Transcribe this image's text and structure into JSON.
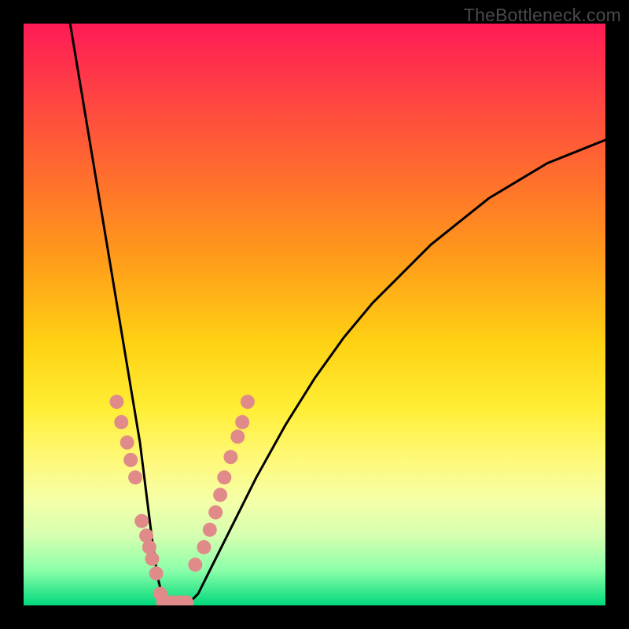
{
  "watermark": {
    "text": "TheBottleneck.com"
  },
  "chart_data": {
    "type": "line",
    "title": "",
    "xlabel": "",
    "ylabel": "",
    "xlim": [
      0,
      100
    ],
    "ylim": [
      0,
      100
    ],
    "grid": false,
    "series": [
      {
        "name": "bottleneck-curve",
        "description": "V-shaped bottleneck curve",
        "x": [
          8,
          10,
          12,
          14,
          16,
          18,
          20,
          21,
          22,
          23,
          24,
          25,
          26,
          28,
          30,
          32,
          35,
          40,
          45,
          50,
          55,
          60,
          65,
          70,
          75,
          80,
          85,
          90,
          95,
          100
        ],
        "y": [
          100,
          88,
          76,
          64,
          52,
          40,
          28,
          20,
          12,
          5,
          1,
          0,
          0,
          0,
          2,
          6,
          12,
          22,
          31,
          39,
          46,
          52,
          57,
          62,
          66,
          70,
          73,
          76,
          78,
          80
        ]
      }
    ],
    "markers": [
      {
        "name": "data-points-left",
        "color": "#e08b89",
        "x": [
          16.0,
          16.8,
          17.8,
          18.4,
          19.2,
          20.3,
          21.1,
          21.6,
          22.1,
          22.8,
          23.5
        ],
        "y": [
          35.0,
          31.5,
          28.0,
          25.0,
          22.0,
          14.5,
          12.0,
          10.0,
          8.0,
          5.5,
          2.0
        ]
      },
      {
        "name": "data-points-right",
        "color": "#e08b89",
        "x": [
          29.5,
          31.0,
          32.0,
          33.0,
          33.8,
          34.5,
          35.6,
          36.8,
          37.6,
          38.5
        ],
        "y": [
          7.0,
          10.0,
          13.0,
          16.0,
          19.0,
          22.0,
          25.5,
          29.0,
          31.5,
          35.0
        ]
      },
      {
        "name": "data-points-bottom",
        "color": "#e08b89",
        "x": [
          24.0,
          25.0,
          26.0,
          27.0,
          28.0
        ],
        "y": [
          0.5,
          0.5,
          0.5,
          0.5,
          0.5
        ]
      }
    ]
  }
}
